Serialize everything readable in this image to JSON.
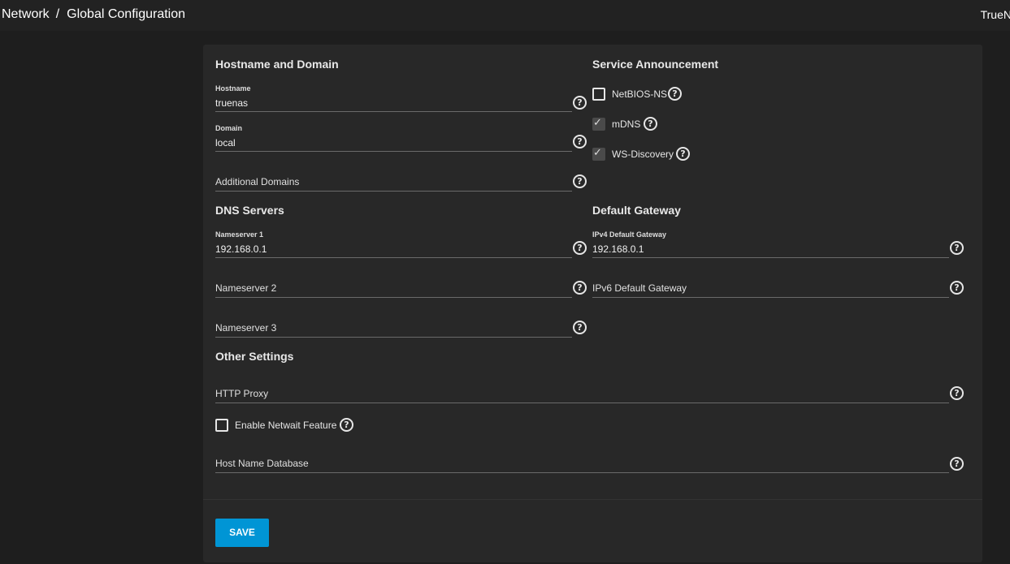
{
  "breadcrumb": {
    "parent": "Network",
    "separator": "/",
    "current": "Global Configuration"
  },
  "brand": "TrueN",
  "sections": {
    "hostname_domain": "Hostname and Domain",
    "service_announcement": "Service Announcement",
    "dns_servers": "DNS Servers",
    "default_gateway": "Default Gateway",
    "other_settings": "Other Settings"
  },
  "fields": {
    "hostname": {
      "label": "Hostname",
      "value": "truenas"
    },
    "domain": {
      "label": "Domain",
      "value": "local"
    },
    "additional_domains": {
      "placeholder": "Additional Domains"
    },
    "nameserver1": {
      "label": "Nameserver 1",
      "value": "192.168.0.1"
    },
    "nameserver2": {
      "placeholder": "Nameserver 2"
    },
    "nameserver3": {
      "placeholder": "Nameserver 3"
    },
    "ipv4_gateway": {
      "label": "IPv4 Default Gateway",
      "value": "192.168.0.1"
    },
    "ipv6_gateway": {
      "placeholder": "IPv6 Default Gateway"
    },
    "http_proxy": {
      "placeholder": "HTTP Proxy"
    },
    "host_name_database": {
      "placeholder": "Host Name Database"
    }
  },
  "checkboxes": {
    "netbios_ns": {
      "label": "NetBIOS-NS",
      "checked": false
    },
    "mdns": {
      "label": "mDNS",
      "checked": true
    },
    "ws_discovery": {
      "label": "WS-Discovery",
      "checked": true
    },
    "netwait": {
      "label": "Enable Netwait Feature",
      "checked": false
    }
  },
  "actions": {
    "save_label": "SAVE"
  },
  "icons": {
    "help": "help-circle-icon",
    "check": "checkmark-icon"
  },
  "colors": {
    "accent": "#0095d5",
    "background": "#1e1e1e",
    "card": "#282828"
  }
}
